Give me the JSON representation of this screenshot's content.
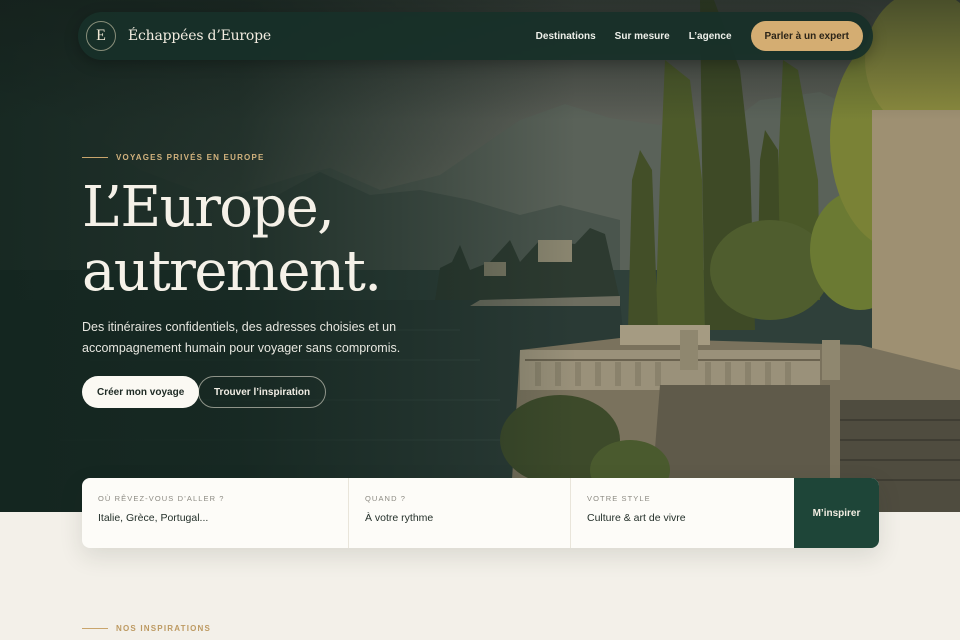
{
  "brand": {
    "mark": "E",
    "name": "Échappées d’Europe"
  },
  "nav": {
    "links": [
      "Destinations",
      "Sur mesure",
      "L’agence"
    ],
    "cta": "Parler à un expert"
  },
  "hero": {
    "eyebrow": "VOYAGES PRIVÉS EN EUROPE",
    "headline_line1": "L’Europe,",
    "headline_line2": "autrement.",
    "intro": "Des itinéraires confidentiels, des adresses choisies et un accompagnement humain pour voyager sans compromis.",
    "primary_button": "Créer mon voyage",
    "secondary_button": "Trouver l’inspiration"
  },
  "search": {
    "fields": [
      {
        "label": "OÙ RÊVEZ-VOUS D’ALLER ?",
        "value": "Italie, Grèce, Portugal..."
      },
      {
        "label": "QUAND ?",
        "value": "À votre rythme"
      },
      {
        "label": "VOTRE STYLE",
        "value": "Culture & art de vivre"
      }
    ],
    "button": "M’inspirer"
  },
  "section": {
    "eyebrow": "NOS INSPIRATIONS"
  },
  "colors": {
    "primary_green": "#1e4538",
    "gold": "#d4ad72",
    "cream": "#f3f0e9"
  }
}
